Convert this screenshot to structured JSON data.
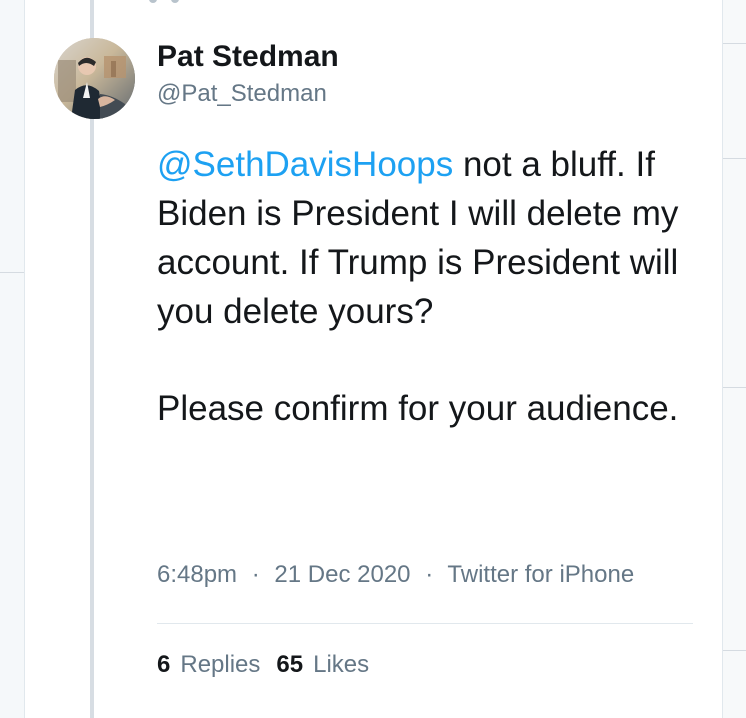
{
  "window": {
    "background": "#e7ebef",
    "card_background": "#ffffff",
    "accent": "#1da1f2"
  },
  "tweet": {
    "author_name": "Pat Stedman",
    "author_handle": "@Pat_Stedman",
    "mention": "@SethDavisHoops",
    "text_line_1_rest": " not a bluff. If Biden is President I will delete my account. If Trump is President will you delete yours?",
    "text_line_2": "Please confirm for your audience.",
    "time": "6:48pm",
    "date": "21 Dec 2020",
    "source": "Twitter for iPhone",
    "separator": "·",
    "replies_count": "6",
    "replies_label": "Replies",
    "likes_count": "65",
    "likes_label": "Likes"
  },
  "icons": {
    "avatar": "profile-photo-icon"
  }
}
